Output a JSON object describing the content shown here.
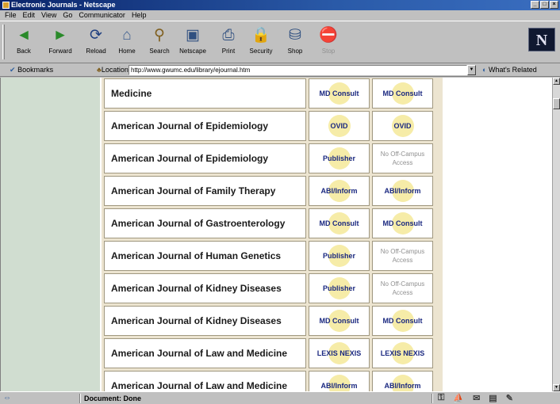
{
  "window": {
    "title": "Electronic Journals - Netscape"
  },
  "menu": {
    "file": "File",
    "edit": "Edit",
    "view": "View",
    "go": "Go",
    "communicator": "Communicator",
    "help": "Help"
  },
  "toolbar": {
    "back": "Back",
    "forward": "Forward",
    "reload": "Reload",
    "home": "Home",
    "search": "Search",
    "netscape": "Netscape",
    "print": "Print",
    "security": "Security",
    "shop": "Shop",
    "stop": "Stop"
  },
  "location": {
    "bookmarks": "Bookmarks",
    "label": "Location:",
    "url": "http://www.gwumc.edu/library/ejournal.htm",
    "related": "What's Related"
  },
  "journals": [
    {
      "name": "Medicine",
      "link1": "MD Consult",
      "link2": "MD Consult"
    },
    {
      "name": "American Journal of Epidemiology",
      "link1": "OVID",
      "link2": "OVID"
    },
    {
      "name": "American Journal of Epidemiology",
      "link1": "Publisher",
      "link2": "No Off-Campus Access"
    },
    {
      "name": "American Journal of Family Therapy",
      "link1": "ABI/Inform",
      "link2": "ABI/Inform"
    },
    {
      "name": "American Journal of Gastroenterology",
      "link1": "MD Consult",
      "link2": "MD Consult"
    },
    {
      "name": "American Journal of Human Genetics",
      "link1": "Publisher",
      "link2": "No Off-Campus Access"
    },
    {
      "name": "American Journal of Kidney Diseases",
      "link1": "Publisher",
      "link2": "No Off-Campus Access"
    },
    {
      "name": "American Journal of Kidney Diseases",
      "link1": "MD Consult",
      "link2": "MD Consult"
    },
    {
      "name": "American Journal of Law and Medicine",
      "link1": "LEXIS NEXIS",
      "link2": "LEXIS NEXIS"
    },
    {
      "name": "American Journal of Law and Medicine",
      "link1": "ABI/Inform",
      "link2": "ABI/Inform"
    }
  ],
  "status": {
    "text": "Document: Done"
  }
}
